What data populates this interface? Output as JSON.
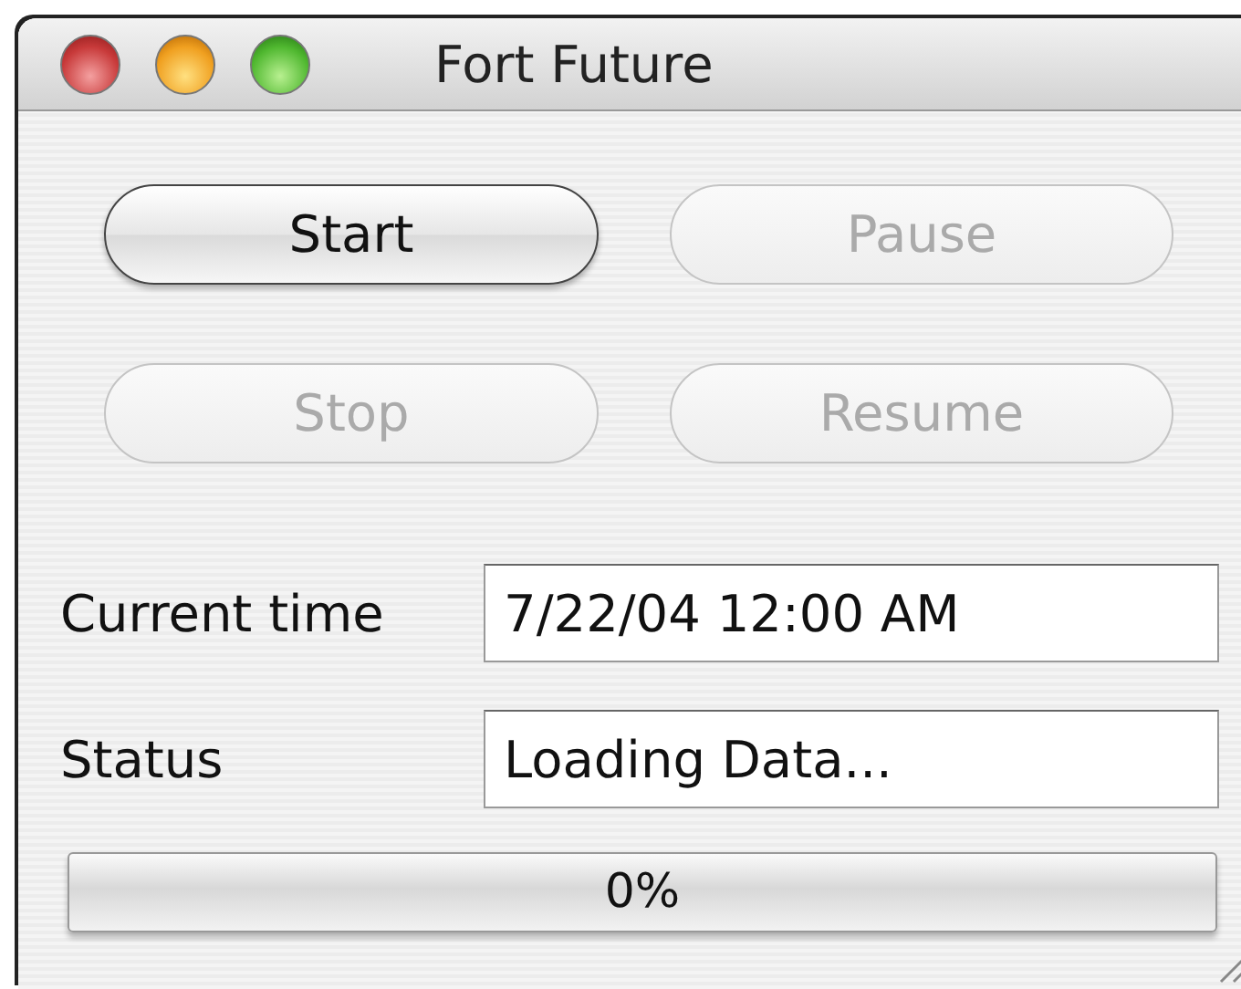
{
  "window": {
    "title": "Fort Future"
  },
  "buttons": [
    {
      "label": "Start",
      "disabled": false
    },
    {
      "label": "Pause",
      "disabled": true
    },
    {
      "label": "Stop",
      "disabled": true
    },
    {
      "label": "Resume",
      "disabled": true
    }
  ],
  "fields": [
    {
      "label": "Current time",
      "value": "7/22/04 12:00 AM"
    },
    {
      "label": "Status",
      "value": "Loading Data..."
    }
  ],
  "progress": {
    "level": 0,
    "label": "0%"
  }
}
